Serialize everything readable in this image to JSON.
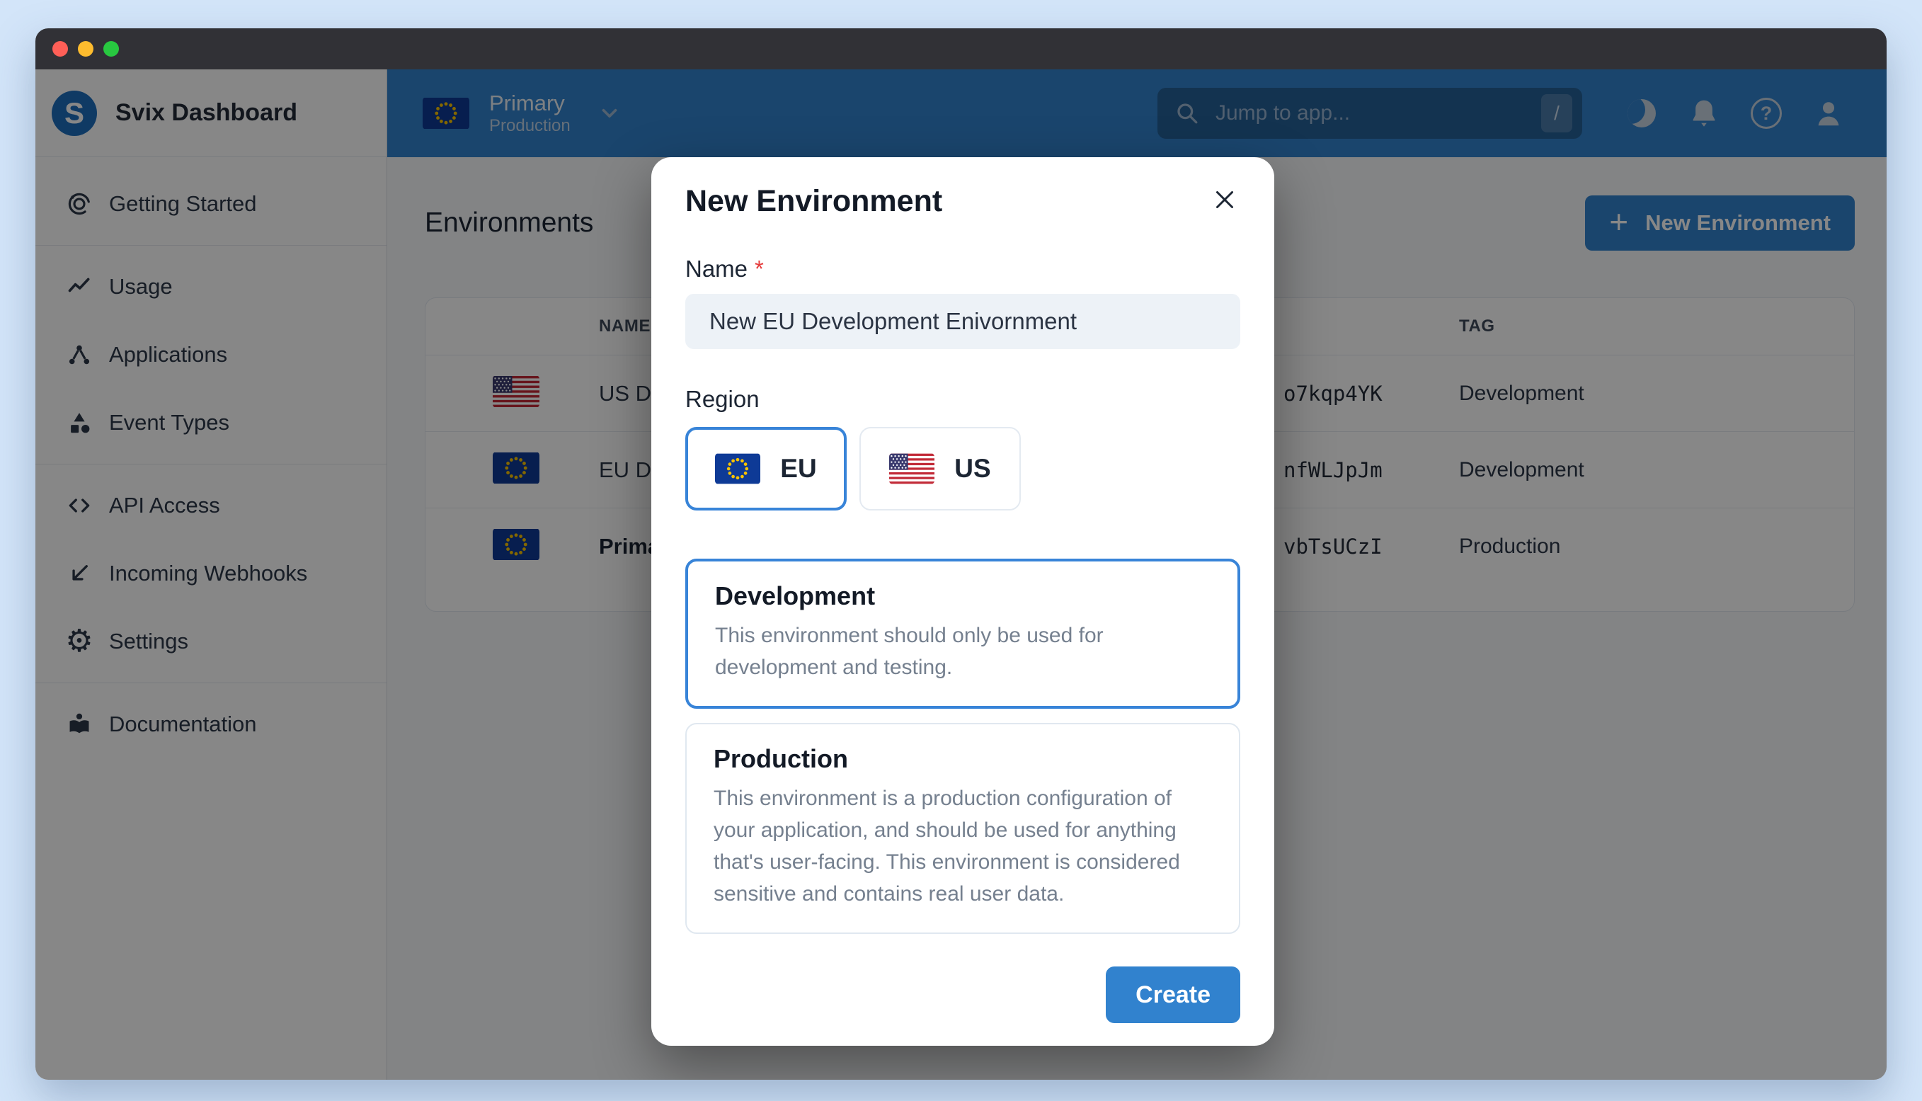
{
  "sidebar": {
    "brand": {
      "logo_letter": "S",
      "title": "Svix Dashboard"
    },
    "groups": [
      {
        "items": [
          {
            "label": "Getting Started",
            "icon": "target-icon"
          }
        ]
      },
      {
        "items": [
          {
            "label": "Usage",
            "icon": "trend-icon"
          },
          {
            "label": "Applications",
            "icon": "nodes-icon"
          },
          {
            "label": "Event Types",
            "icon": "shapes-icon"
          }
        ]
      },
      {
        "items": [
          {
            "label": "API Access",
            "icon": "code-icon"
          },
          {
            "label": "Incoming Webhooks",
            "icon": "incoming-arrow-icon"
          },
          {
            "label": "Settings",
            "icon": "gear-icon"
          }
        ]
      },
      {
        "items": [
          {
            "label": "Documentation",
            "icon": "book-icon"
          }
        ]
      }
    ]
  },
  "topbar": {
    "environment_switcher": {
      "name": "Primary",
      "tag": "Production",
      "flag": "eu"
    },
    "search": {
      "placeholder": "Jump to app...",
      "shortcut_key": "/"
    },
    "icon_buttons": [
      "moon-icon",
      "bell-icon",
      "help-icon",
      "user-icon"
    ]
  },
  "icons": {
    "gear_glyph": "⚙",
    "help_glyph": "?",
    "plus_glyph": "+"
  },
  "page": {
    "title": "Environments",
    "primary_action": "New Environment",
    "table": {
      "headers": {
        "name": "NAME",
        "tag": "TAG"
      },
      "rows": [
        {
          "flag": "us",
          "name": "US D",
          "id": "o7kqp4YK",
          "tag": "Development",
          "emphasis": false
        },
        {
          "flag": "eu",
          "name": "EU D",
          "id": "nfWLJpJm",
          "tag": "Development",
          "emphasis": false
        },
        {
          "flag": "eu",
          "name": "Prima",
          "id": "vbTsUCzI",
          "tag": "Production",
          "emphasis": true
        }
      ]
    }
  },
  "modal": {
    "title": "New Environment",
    "fields": {
      "name": {
        "label": "Name",
        "required_mark": "*",
        "value": "New EU Development Enivornment"
      },
      "region": {
        "label": "Region",
        "options": [
          {
            "label": "EU",
            "flag": "eu",
            "selected": true
          },
          {
            "label": "US",
            "flag": "us",
            "selected": false
          }
        ]
      },
      "env_type": {
        "options": [
          {
            "title": "Development",
            "description": "This environment should only be used for development and testing.",
            "selected": true
          },
          {
            "title": "Production",
            "description": "This environment is a production configuration of your application, and should be used for anything that's user-facing. This environment is considered sensitive and contains real user data.",
            "selected": false
          }
        ]
      }
    },
    "submit_label": "Create"
  },
  "colors": {
    "accent": "#3182ce",
    "topbar_background": "#3182ce",
    "selected_border": "#3884d8",
    "overlay": "rgba(0,0,0,0.47)",
    "required_asterisk": "#e53e3e",
    "desktop_background": "#d3e5f9",
    "titlebar_background": "#313136",
    "traffic_lights": [
      "#ff5f57",
      "#febc2e",
      "#28c840"
    ]
  }
}
